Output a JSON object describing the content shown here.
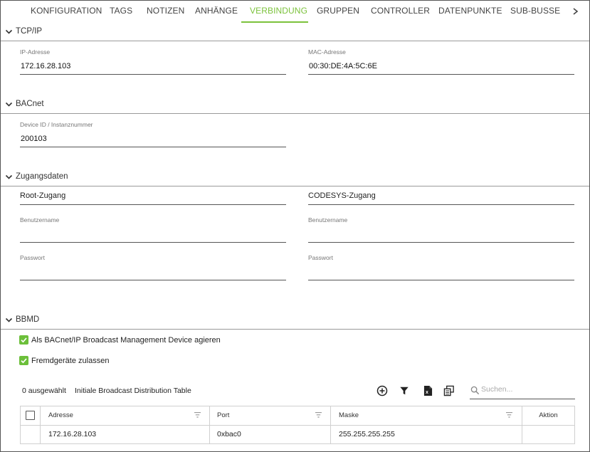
{
  "tabs": [
    {
      "label": "KONFIGURATION",
      "active": false
    },
    {
      "label": "TAGS",
      "active": false
    },
    {
      "label": "NOTIZEN",
      "active": false
    },
    {
      "label": "ANHÄNGE",
      "active": false
    },
    {
      "label": "VERBINDUNG",
      "active": true
    },
    {
      "label": "GRUPPEN",
      "active": false
    },
    {
      "label": "CONTROLLER",
      "active": false
    },
    {
      "label": "DATENPUNKTE",
      "active": false
    },
    {
      "label": "SUB-BUSSE",
      "active": false
    }
  ],
  "accent_color": "#7cc23c",
  "checkbox_color": "#6cbf3a",
  "tcpip": {
    "title": "TCP/IP",
    "ip_label": "IP-Adresse",
    "ip_value": "172.16.28.103",
    "mac_label": "MAC-Adresse",
    "mac_value": "00:30:DE:4A:5C:6E"
  },
  "bacnet": {
    "title": "BACnet",
    "device_label": "Device ID / Instanznummer",
    "device_value": "200103"
  },
  "zugang": {
    "title": "Zugangsdaten",
    "root": {
      "title": "Root-Zugang",
      "user_label": "Benutzername",
      "user_value": "",
      "pass_label": "Passwort",
      "pass_value": ""
    },
    "codesys": {
      "title": "CODESYS-Zugang",
      "user_label": "Benutzername",
      "user_value": "",
      "pass_label": "Passwort",
      "pass_value": ""
    }
  },
  "bbmd": {
    "title": "BBMD",
    "checkbox1": {
      "label": "Als BACnet/IP Broadcast Management Device agieren",
      "checked": true
    },
    "checkbox2": {
      "label": "Fremdgeräte zulassen",
      "checked": true
    },
    "selected_count": "0 ausgewählt",
    "table_title": "Initiale Broadcast Distribution Table",
    "search_placeholder": "Suchen...",
    "toolbar_icons": [
      "add-circle-icon",
      "filter-icon",
      "excel-export-icon",
      "column-config-icon"
    ],
    "columns": [
      "Adresse",
      "Port",
      "Maske",
      "Aktion"
    ],
    "rows": [
      {
        "adresse": "172.16.28.103",
        "port": "0xbac0",
        "maske": "255.255.255.255",
        "aktion": ""
      }
    ]
  }
}
